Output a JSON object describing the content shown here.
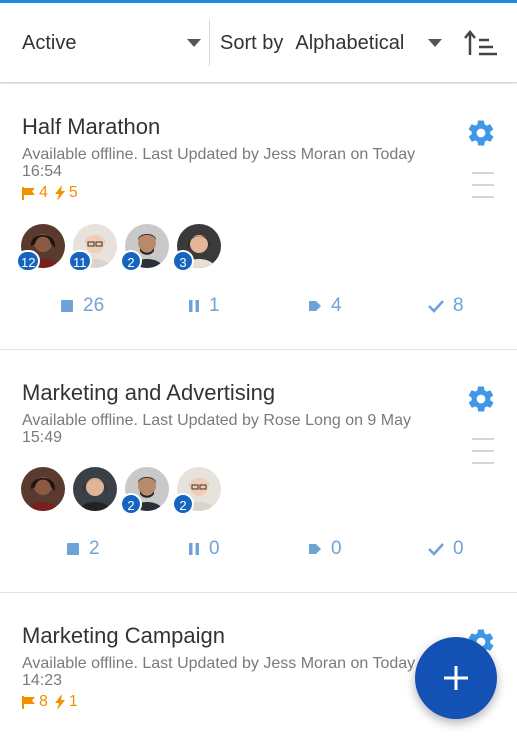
{
  "toolbar": {
    "filter_value": "Active",
    "sort_label": "Sort by",
    "sort_value": "Alphabetical"
  },
  "colors": {
    "accent": "#1e88e5",
    "icon_blue": "#6fa3d8",
    "flag_orange": "#f29000",
    "badge_blue": "#1565c0",
    "fab_blue": "#1451b4"
  },
  "boards": [
    {
      "title": "Half Marathon",
      "subtitle": "Available offline. Last Updated by Jess Moran on Today 16:54",
      "flags_count": "4",
      "bolts_count": "5",
      "members": [
        {
          "name": "member-1",
          "badge": "12"
        },
        {
          "name": "member-2",
          "badge": "11"
        },
        {
          "name": "member-3",
          "badge": "2"
        },
        {
          "name": "member-4",
          "badge": "3"
        }
      ],
      "stats": {
        "cards": "26",
        "paused": "1",
        "moving": "4",
        "done": "8"
      }
    },
    {
      "title": "Marketing and Advertising",
      "subtitle": "Available offline. Last Updated by Rose Long on 9 May 15:49",
      "members": [
        {
          "name": "member-1",
          "badge": ""
        },
        {
          "name": "member-2",
          "badge": ""
        },
        {
          "name": "member-3",
          "badge": "2"
        },
        {
          "name": "member-4",
          "badge": "2"
        }
      ],
      "stats": {
        "cards": "2",
        "paused": "0",
        "moving": "0",
        "done": "0"
      }
    },
    {
      "title": "Marketing Campaign",
      "subtitle": "Available offline. Last Updated by Jess Moran on Today 14:23",
      "flags_count": "8",
      "bolts_count": "1"
    }
  ],
  "icons": {
    "filter_caret": "chevron-down-icon",
    "sort_caret": "chevron-down-icon",
    "sort_order": "sort-ascending-icon",
    "settings": "gear-icon",
    "drag": "drag-handle-icon",
    "flag": "flag-icon",
    "bolt": "lightning-icon",
    "cards": "square-icon",
    "paused": "pause-icon",
    "moving": "arrow-tag-icon",
    "done": "check-icon",
    "fab": "plus-icon"
  }
}
